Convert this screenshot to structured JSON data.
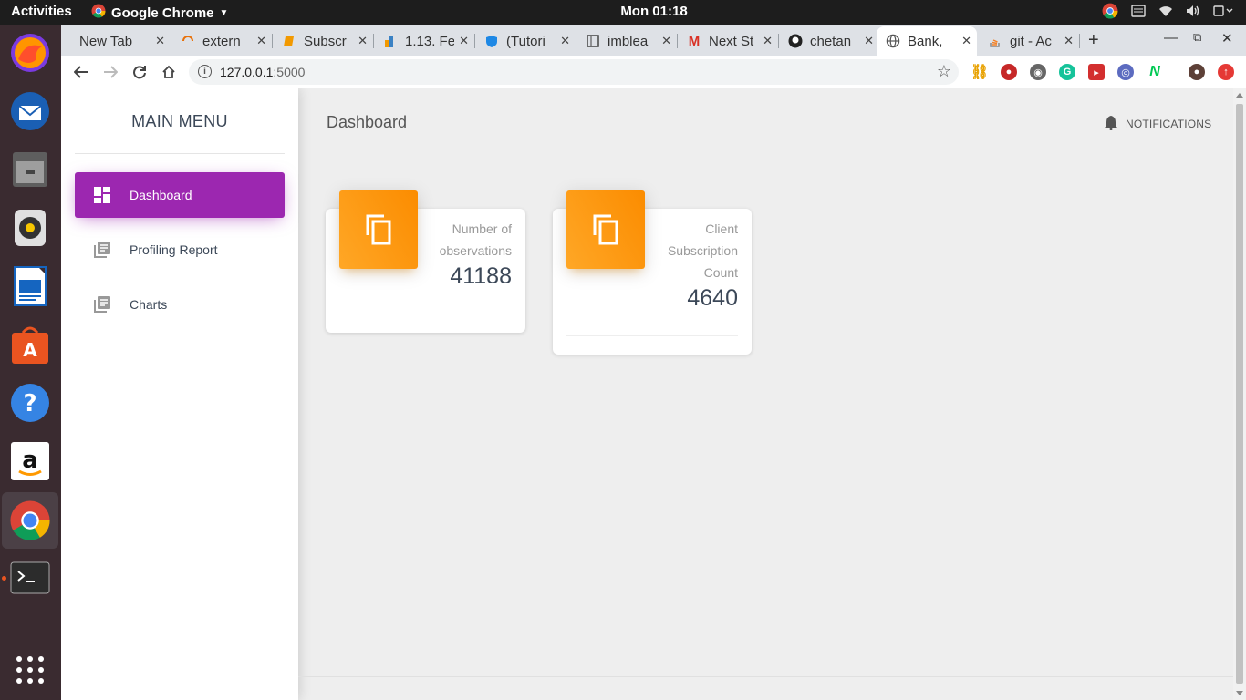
{
  "os": {
    "activities_label": "Activities",
    "app_menu_label": "Google Chrome",
    "clock": "Mon 01:18"
  },
  "browser": {
    "tabs": [
      {
        "label": "New Tab"
      },
      {
        "label": "extern"
      },
      {
        "label": "Subscr"
      },
      {
        "label": "1.13. Fe"
      },
      {
        "label": "(Tutori"
      },
      {
        "label": "imblea"
      },
      {
        "label": "Next St"
      },
      {
        "label": "chetan"
      },
      {
        "label": "Bank, F"
      },
      {
        "label": "git - Ac"
      }
    ],
    "url_host": "127.0.0.1",
    "url_port": ":5000"
  },
  "sidebar": {
    "title": "MAIN MENU",
    "items": [
      {
        "label": "Dashboard"
      },
      {
        "label": "Profiling Report"
      },
      {
        "label": "Charts"
      }
    ]
  },
  "main": {
    "title": "Dashboard",
    "notifications_label": "NOTIFICATIONS",
    "cards": [
      {
        "category_lines": [
          "Number of",
          "observations"
        ],
        "value": "41188"
      },
      {
        "category_lines": [
          "Client",
          "Subscription",
          "Count"
        ],
        "value": "4640"
      }
    ]
  },
  "colors": {
    "accent": "#9c27b0",
    "card_icon": "#fb8c00"
  }
}
